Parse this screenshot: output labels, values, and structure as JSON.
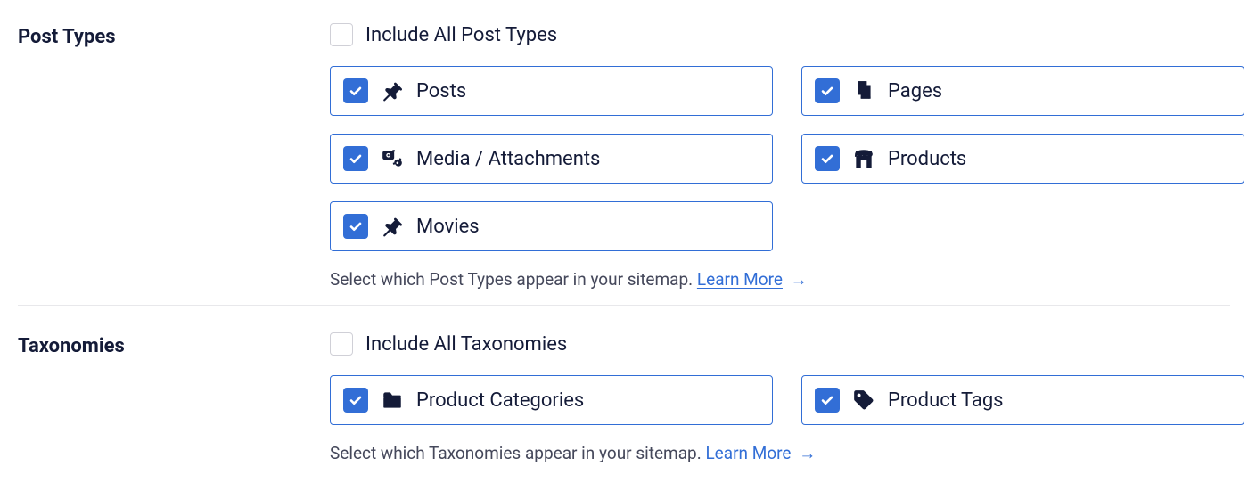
{
  "postTypes": {
    "heading": "Post Types",
    "includeAll": {
      "label": "Include All Post Types",
      "checked": false
    },
    "options": [
      {
        "key": "posts",
        "label": "Posts",
        "icon": "thumbtack",
        "checked": true
      },
      {
        "key": "pages",
        "label": "Pages",
        "icon": "pages",
        "checked": true
      },
      {
        "key": "media",
        "label": "Media / Attachments",
        "icon": "media",
        "checked": true
      },
      {
        "key": "products",
        "label": "Products",
        "icon": "shop",
        "checked": true
      },
      {
        "key": "movies",
        "label": "Movies",
        "icon": "thumbtack",
        "checked": true
      }
    ],
    "helperText": "Select which Post Types appear in your sitemap.",
    "learnMore": "Learn More"
  },
  "taxonomies": {
    "heading": "Taxonomies",
    "includeAll": {
      "label": "Include All Taxonomies",
      "checked": false
    },
    "options": [
      {
        "key": "product-categories",
        "label": "Product Categories",
        "icon": "folder",
        "checked": true
      },
      {
        "key": "product-tags",
        "label": "Product Tags",
        "icon": "tag",
        "checked": true
      }
    ],
    "helperText": "Select which Taxonomies appear in your sitemap.",
    "learnMore": "Learn More"
  },
  "colors": {
    "accent": "#326ed6",
    "text": "#141b38"
  }
}
